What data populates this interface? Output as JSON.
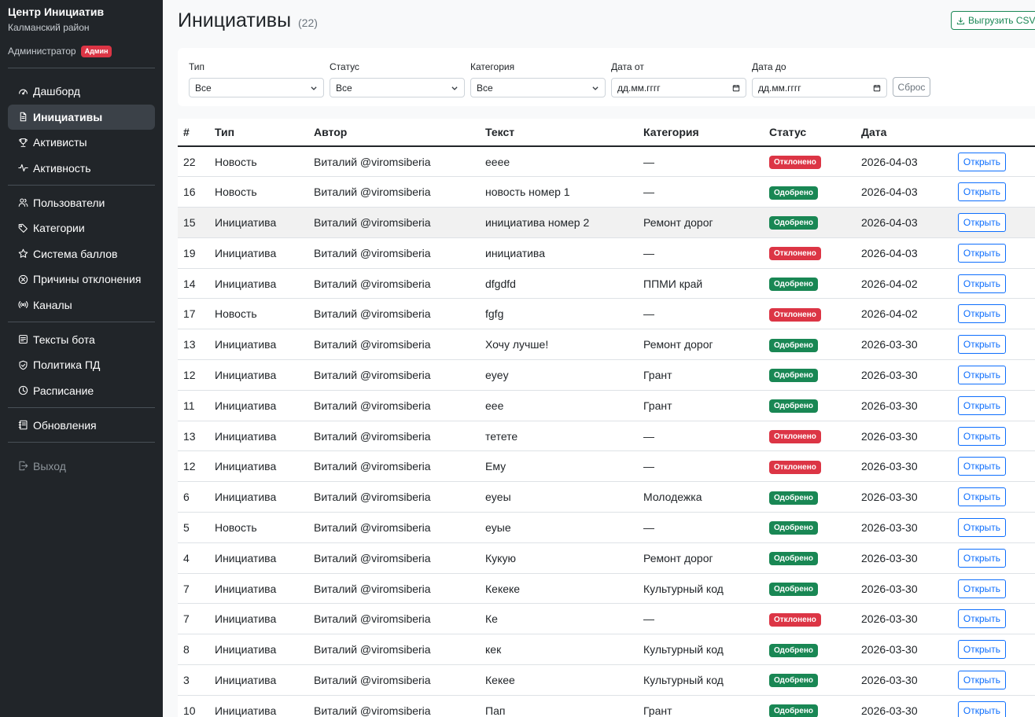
{
  "sidebar": {
    "brand_title": "Центр Инициатив",
    "brand_sub": "Калманский район",
    "role": "Администратор",
    "role_badge": "Админ",
    "groups": [
      [
        {
          "label": "Дашборд",
          "icon": "speedometer-icon"
        },
        {
          "label": "Инициативы",
          "icon": "file-icon",
          "active": true
        },
        {
          "label": "Активисты",
          "icon": "trophy-icon"
        },
        {
          "label": "Активность",
          "icon": "activity-icon"
        }
      ],
      [
        {
          "label": "Пользователи",
          "icon": "people-icon"
        },
        {
          "label": "Категории",
          "icon": "tag-icon"
        },
        {
          "label": "Система баллов",
          "icon": "star-icon"
        },
        {
          "label": "Причины отклонения",
          "icon": "x-circle-icon"
        },
        {
          "label": "Каналы",
          "icon": "broadcast-icon"
        }
      ],
      [
        {
          "label": "Тексты бота",
          "icon": "text-icon"
        },
        {
          "label": "Политика ПД",
          "icon": "shield-icon"
        },
        {
          "label": "Расписание",
          "icon": "clock-icon"
        }
      ],
      [
        {
          "label": "Обновления",
          "icon": "journal-icon"
        }
      ],
      [
        {
          "label": "Выход",
          "icon": "logout-icon",
          "muted": true
        }
      ]
    ]
  },
  "header": {
    "title": "Инициативы",
    "count": "(22)",
    "csv_label": "Выгрузить CSV"
  },
  "filters": {
    "type_label": "Тип",
    "type_value": "Все",
    "status_label": "Статус",
    "status_value": "Все",
    "category_label": "Категория",
    "category_value": "Все",
    "date_from_label": "Дата от",
    "date_from_placeholder": "дд.мм.гггг",
    "date_to_label": "Дата до",
    "date_to_placeholder": "дд.мм.гггг",
    "reset_label": "Сброс"
  },
  "table": {
    "columns": [
      "#",
      "Тип",
      "Автор",
      "Текст",
      "Категория",
      "Статус",
      "Дата"
    ],
    "open_label": "Открыть",
    "rows": [
      {
        "id": "22",
        "type": "Новость",
        "author": "Виталий @viromsiberia",
        "text": "eeee",
        "category": "—",
        "status": "Отклонено",
        "status_kind": "no",
        "date": "2026-04-03"
      },
      {
        "id": "16",
        "type": "Новость",
        "author": "Виталий @viromsiberia",
        "text": "новость номер 1",
        "category": "—",
        "status": "Одобрено",
        "status_kind": "ok",
        "date": "2026-04-03"
      },
      {
        "id": "15",
        "type": "Инициатива",
        "author": "Виталий @viromsiberia",
        "text": "инициатива номер 2",
        "category": "Ремонт дорог",
        "status": "Одобрено",
        "status_kind": "ok",
        "date": "2026-04-03",
        "highlight": true
      },
      {
        "id": "19",
        "type": "Инициатива",
        "author": "Виталий @viromsiberia",
        "text": "инициатива",
        "category": "—",
        "status": "Отклонено",
        "status_kind": "no",
        "date": "2026-04-03"
      },
      {
        "id": "14",
        "type": "Инициатива",
        "author": "Виталий @viromsiberia",
        "text": "dfgdfd",
        "category": "ППМИ край",
        "status": "Одобрено",
        "status_kind": "ok",
        "date": "2026-04-02"
      },
      {
        "id": "17",
        "type": "Новость",
        "author": "Виталий @viromsiberia",
        "text": "fgfg",
        "category": "—",
        "status": "Отклонено",
        "status_kind": "no",
        "date": "2026-04-02"
      },
      {
        "id": "13",
        "type": "Инициатива",
        "author": "Виталий @viromsiberia",
        "text": "Хочу лучше!",
        "category": "Ремонт дорог",
        "status": "Одобрено",
        "status_kind": "ok",
        "date": "2026-03-30"
      },
      {
        "id": "12",
        "type": "Инициатива",
        "author": "Виталий @viromsiberia",
        "text": "eyey",
        "category": "Грант",
        "status": "Одобрено",
        "status_kind": "ok",
        "date": "2026-03-30"
      },
      {
        "id": "11",
        "type": "Инициатива",
        "author": "Виталий @viromsiberia",
        "text": "eee",
        "category": "Грант",
        "status": "Одобрено",
        "status_kind": "ok",
        "date": "2026-03-30"
      },
      {
        "id": "13",
        "type": "Инициатива",
        "author": "Виталий @viromsiberia",
        "text": "тетете",
        "category": "—",
        "status": "Отклонено",
        "status_kind": "no",
        "date": "2026-03-30"
      },
      {
        "id": "12",
        "type": "Инициатива",
        "author": "Виталий @viromsiberia",
        "text": "Ему",
        "category": "—",
        "status": "Отклонено",
        "status_kind": "no",
        "date": "2026-03-30"
      },
      {
        "id": "6",
        "type": "Инициатива",
        "author": "Виталий @viromsiberia",
        "text": "eyeы",
        "category": "Молодежка",
        "status": "Одобрено",
        "status_kind": "ok",
        "date": "2026-03-30"
      },
      {
        "id": "5",
        "type": "Новость",
        "author": "Виталий @viromsiberia",
        "text": "eyыe",
        "category": "—",
        "status": "Одобрено",
        "status_kind": "ok",
        "date": "2026-03-30"
      },
      {
        "id": "4",
        "type": "Инициатива",
        "author": "Виталий @viromsiberia",
        "text": "Кукую",
        "category": "Ремонт дорог",
        "status": "Одобрено",
        "status_kind": "ok",
        "date": "2026-03-30"
      },
      {
        "id": "7",
        "type": "Инициатива",
        "author": "Виталий @viromsiberia",
        "text": "Кекеке",
        "category": "Культурный код",
        "status": "Одобрено",
        "status_kind": "ok",
        "date": "2026-03-30"
      },
      {
        "id": "7",
        "type": "Инициатива",
        "author": "Виталий @viromsiberia",
        "text": "Ке",
        "category": "—",
        "status": "Отклонено",
        "status_kind": "no",
        "date": "2026-03-30"
      },
      {
        "id": "8",
        "type": "Инициатива",
        "author": "Виталий @viromsiberia",
        "text": "кек",
        "category": "Культурный код",
        "status": "Одобрено",
        "status_kind": "ok",
        "date": "2026-03-30"
      },
      {
        "id": "3",
        "type": "Инициатива",
        "author": "Виталий @viromsiberia",
        "text": "Кекее",
        "category": "Культурный код",
        "status": "Одобрено",
        "status_kind": "ok",
        "date": "2026-03-30"
      },
      {
        "id": "10",
        "type": "Инициатива",
        "author": "Виталий @viromsiberia",
        "text": "Пап",
        "category": "Грант",
        "status": "Одобрено",
        "status_kind": "ok",
        "date": "2026-03-30"
      }
    ]
  },
  "colors": {
    "sidebar_bg": "#212529",
    "approved": "#198754",
    "rejected": "#dc3545",
    "primary": "#0d6efd"
  }
}
